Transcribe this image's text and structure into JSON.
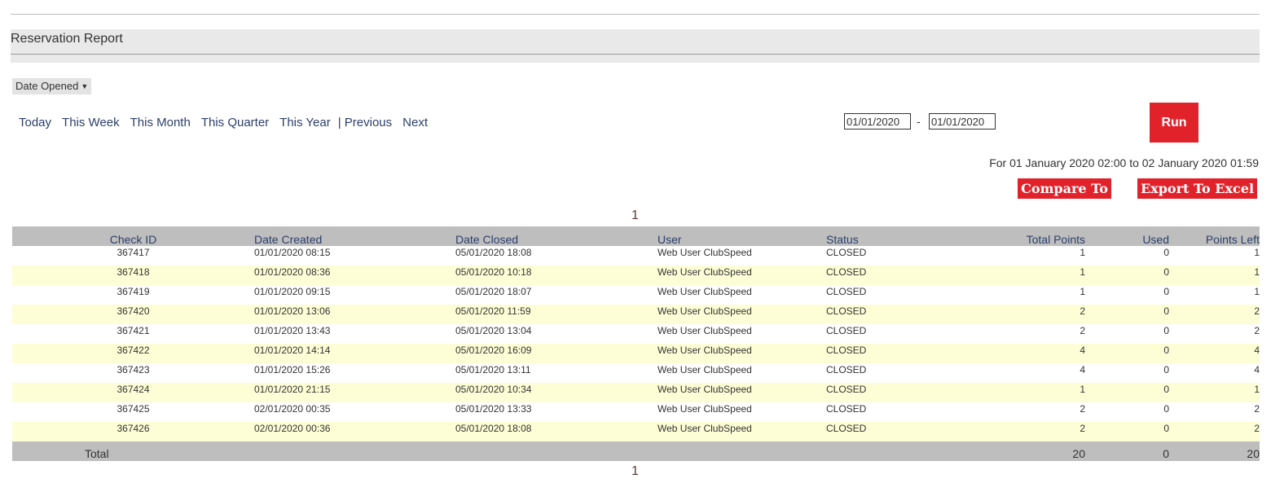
{
  "report": {
    "title": "Reservation Report"
  },
  "filter": {
    "date_type": "Date Opened"
  },
  "nav": {
    "today": "Today",
    "this_week": "This Week",
    "this_month": "This Month",
    "this_quarter": "This Quarter",
    "this_year": "This Year",
    "previous": "| Previous",
    "next": "Next"
  },
  "dates": {
    "from": "01/01/2020",
    "separator": "-",
    "to": "01/01/2020"
  },
  "buttons": {
    "run": "Run",
    "compare": "Compare To",
    "export": "Export To Excel"
  },
  "range_text": "For 01 January 2020 02:00 to 02 January 2020 01:59",
  "pager": {
    "top": "1",
    "bottom": "1"
  },
  "table": {
    "headers": [
      "Check ID",
      "Date Created",
      "Date Closed",
      "User",
      "Status",
      "Total Points",
      "Used",
      "Points Left"
    ],
    "rows": [
      [
        "367417",
        "01/01/2020 08:15",
        "05/01/2020 18:08",
        "Web User ClubSpeed",
        "CLOSED",
        "1",
        "0",
        "1"
      ],
      [
        "367418",
        "01/01/2020 08:36",
        "05/01/2020 10:18",
        "Web User ClubSpeed",
        "CLOSED",
        "1",
        "0",
        "1"
      ],
      [
        "367419",
        "01/01/2020 09:15",
        "05/01/2020 18:07",
        "Web User ClubSpeed",
        "CLOSED",
        "1",
        "0",
        "1"
      ],
      [
        "367420",
        "01/01/2020 13:06",
        "05/01/2020 11:59",
        "Web User ClubSpeed",
        "CLOSED",
        "2",
        "0",
        "2"
      ],
      [
        "367421",
        "01/01/2020 13:43",
        "05/01/2020 13:04",
        "Web User ClubSpeed",
        "CLOSED",
        "2",
        "0",
        "2"
      ],
      [
        "367422",
        "01/01/2020 14:14",
        "05/01/2020 16:09",
        "Web User ClubSpeed",
        "CLOSED",
        "4",
        "0",
        "4"
      ],
      [
        "367423",
        "01/01/2020 15:26",
        "05/01/2020 13:11",
        "Web User ClubSpeed",
        "CLOSED",
        "4",
        "0",
        "4"
      ],
      [
        "367424",
        "01/01/2020 21:15",
        "05/01/2020 10:34",
        "Web User ClubSpeed",
        "CLOSED",
        "1",
        "0",
        "1"
      ],
      [
        "367425",
        "02/01/2020 00:35",
        "05/01/2020 13:33",
        "Web User ClubSpeed",
        "CLOSED",
        "2",
        "0",
        "2"
      ],
      [
        "367426",
        "02/01/2020 00:36",
        "05/01/2020 18:08",
        "Web User ClubSpeed",
        "CLOSED",
        "2",
        "0",
        "2"
      ]
    ],
    "footer": {
      "label": "Total",
      "total_points": "20",
      "used": "0",
      "points_left": "20"
    }
  },
  "colors": {
    "accent_red": "#e2222b",
    "header_gray": "#bebebe",
    "stripe_yellow": "#fefed6",
    "link_blue": "#2c3e6a"
  }
}
